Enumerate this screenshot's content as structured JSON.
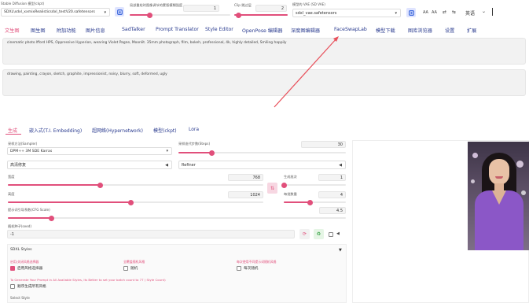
{
  "header": {
    "model_label": "Stable Diffusion 模型(ckpt)",
    "model_value": "SDXL\\sdxl_xxmixRealisticsdxl_testV20.safetensors",
    "clip_hint_label": "局部重绘时图像调节的蒙版模糊强度",
    "clip_hint_value": "1",
    "clip_hint_fraction": 0.2,
    "clip_skip_label": "Clip 跳过层",
    "clip_skip_value": "2",
    "vae_label": "模型的 VAE (SD VAE)",
    "vae_value": "sdxl_vae.safetensors",
    "right_icons": [
      "AA",
      "AA",
      "⇄",
      "⇆"
    ],
    "language": "英语",
    "language_caret": "⌄"
  },
  "main_tabs": [
    "文生图",
    "图生图",
    "附加功能",
    "图片信息",
    "SadTalker",
    "Prompt Translator",
    "Style Editor",
    "OpenPose 编辑器",
    "深度图编辑器",
    "FaceSwapLab",
    "模型下载",
    "图库浏览器",
    "设置",
    "扩展"
  ],
  "prompt": {
    "positive": "cinematic photo lfford HPS, Oppressive Hyperion, wearing Violet Pagne, Moonlit. 35mm photograph, film, bokeh, professional, 4k, highly detailed, Smiling happily",
    "negative": "drawing, painting, crayon, sketch, graphite, impressionist, noisy, blurry, soft, deformed, ugly"
  },
  "sub_tabs": [
    "生成",
    "嵌入式(T.I. Embedding)",
    "超网络(Hypernetwork)",
    "模型(ckpt)",
    "Lora"
  ],
  "sampler": {
    "label": "采样方法(Sampler)",
    "value": "DPM++ 3M SDE Karras",
    "steps_label": "采样迭代步数(Steps)",
    "steps_value": "30",
    "steps_fraction": 0.2,
    "hires_label": "高清修复",
    "refiner_label": "Refiner"
  },
  "dims": {
    "width_label": "宽度",
    "width_value": "768",
    "width_fraction": 0.36,
    "height_label": "高度",
    "height_value": "1024",
    "height_fraction": 0.48,
    "batch_count_label": "生成批次",
    "batch_count_value": "1",
    "batch_count_fraction": 0.0,
    "batch_size_label": "每批数量",
    "batch_size_value": "4",
    "batch_size_fraction": 0.43,
    "swap_icon": "⇅"
  },
  "cfg": {
    "label": "提示词引导系数(CFG Scale)",
    "value": "4.5",
    "fraction": 0.13
  },
  "seed": {
    "label": "随机种子(seed)",
    "value": "-1",
    "dice_icon": "⟳",
    "recycle_icon": "♻",
    "dropdown_caret": "◀"
  },
  "styles": {
    "title": "SDXL Styles",
    "caret": "▼",
    "enable_group_label": "启用/关闭风格选择器",
    "enable_label": "启用风格选择器",
    "random_group_label": "全覆盖随机风格",
    "random_label": "随机",
    "each_group_label": "每次使用不同提示词随机风格",
    "each_label": "每次随机",
    "note": "To Generate Your Prompt in All Available Styles, Its Better to set your batch count to 77 ( Style Count)",
    "all_label": "顺序生成所有风格",
    "bottom_label": "Select Style"
  },
  "colors": {
    "accent": "#e14f7b",
    "tab_text": "#2a3b8f",
    "icon_bg": "#dfe4ff",
    "arrow": "#e8505b"
  }
}
